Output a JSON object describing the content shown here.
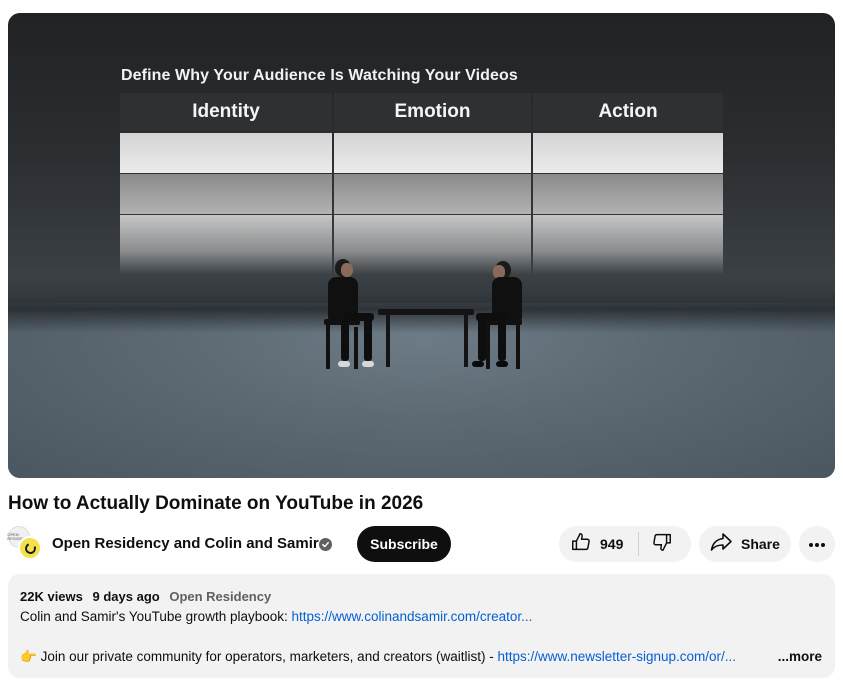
{
  "player": {
    "slide": {
      "title": "Define Why Your Audience Is Watching Your Videos",
      "columns": [
        "Identity",
        "Emotion",
        "Action"
      ]
    }
  },
  "video": {
    "title": "How to Actually Dominate on YouTube in 2026"
  },
  "channel": {
    "name": "Open Residency and Colin and Samir",
    "subscribe_label": "Subscribe",
    "avatar_text": "OPEN RESIDENCY"
  },
  "actions": {
    "like_count": "949",
    "share_label": "Share"
  },
  "description": {
    "views": "22K views",
    "age": "9 days ago",
    "tag": "Open Residency",
    "line1_text": "Colin and Samir's YouTube growth playbook: ",
    "line1_link": "https://www.colinandsamir.com/creator...",
    "line2_emoji": "👉",
    "line2_text": " Join our private community for operators, marketers, and creators (waitlist) - ",
    "line2_link": "https://www.newsletter-signup.com/or/...",
    "more_label": "...more"
  },
  "colors": {
    "link": "#065fd4",
    "subscribe_bg": "#0f0f0f",
    "pill_bg": "#f2f2f2"
  }
}
